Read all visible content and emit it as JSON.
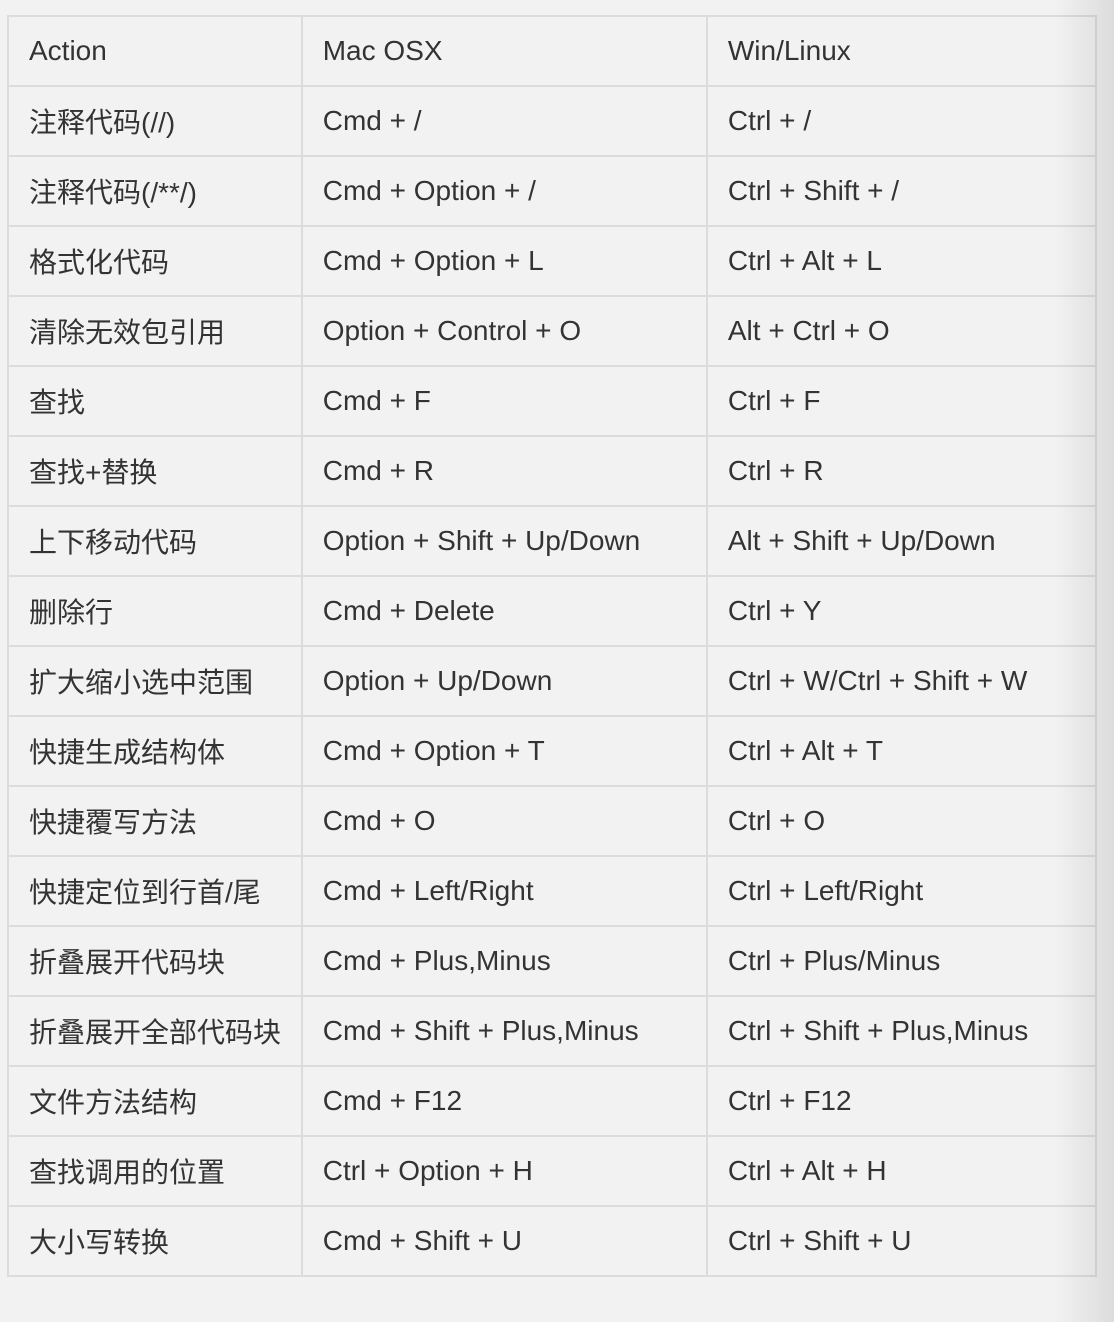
{
  "table": {
    "headers": [
      "Action",
      "Mac OSX",
      "Win/Linux"
    ],
    "rows": [
      [
        "注释代码(//)",
        "Cmd + /",
        "Ctrl + /"
      ],
      [
        "注释代码(/**/)",
        "Cmd + Option + /",
        "Ctrl + Shift + /"
      ],
      [
        "格式化代码",
        "Cmd + Option + L",
        "Ctrl + Alt + L"
      ],
      [
        "清除无效包引用",
        "Option + Control + O",
        "Alt + Ctrl + O"
      ],
      [
        "查找",
        "Cmd + F",
        "Ctrl + F"
      ],
      [
        "查找+替换",
        "Cmd + R",
        "Ctrl + R"
      ],
      [
        "上下移动代码",
        "Option + Shift + Up/Down",
        "Alt + Shift + Up/Down"
      ],
      [
        "删除行",
        "Cmd + Delete",
        "Ctrl + Y"
      ],
      [
        "扩大缩小选中范围",
        "Option + Up/Down",
        "Ctrl + W/Ctrl + Shift + W"
      ],
      [
        "快捷生成结构体",
        "Cmd + Option + T",
        "Ctrl + Alt + T"
      ],
      [
        "快捷覆写方法",
        "Cmd + O",
        "Ctrl + O"
      ],
      [
        "快捷定位到行首/尾",
        "Cmd + Left/Right",
        "Ctrl + Left/Right"
      ],
      [
        "折叠展开代码块",
        "Cmd + Plus,Minus",
        "Ctrl + Plus/Minus"
      ],
      [
        "折叠展开全部代码块",
        "Cmd + Shift + Plus,Minus",
        "Ctrl + Shift + Plus,Minus"
      ],
      [
        "文件方法结构",
        "Cmd + F12",
        "Ctrl + F12"
      ],
      [
        "查找调用的位置",
        "Ctrl + Option + H",
        "Ctrl + Alt + H"
      ],
      [
        "大小写转换",
        "Cmd + Shift + U",
        "Ctrl + Shift + U"
      ]
    ]
  }
}
